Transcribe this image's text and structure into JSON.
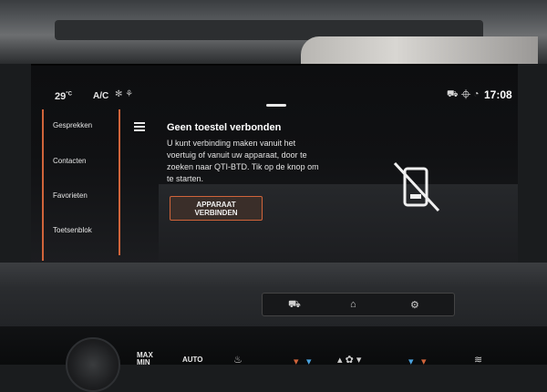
{
  "status": {
    "temperature": "29",
    "temperature_unit": "°C",
    "ac_label": "A/C",
    "clock": "17:08",
    "icons": [
      "fan-icon",
      "car-icon",
      "location-icon",
      "signal-icon"
    ]
  },
  "sidebar": {
    "items": [
      {
        "label": "Gesprekken"
      },
      {
        "label": "Contacten"
      },
      {
        "label": "Favorieten"
      },
      {
        "label": "Toetsenblok"
      }
    ]
  },
  "main": {
    "title": "Geen toestel verbonden",
    "description": "U kunt verbinding maken vanuit het voertuig of vanuit uw apparaat, door te zoeken naar QTI-BTD. Tik op de knop om te starten.",
    "connect_button": "APPARAAT VERBINDEN",
    "status_icon": "phone-disconnected-icon"
  },
  "console": {
    "buttons": [
      "car-icon",
      "home-icon",
      "car-settings-icon"
    ],
    "climate": {
      "max_label": "MAX\nMIN",
      "auto_label": "AUTO"
    }
  },
  "colors": {
    "accent": "#d0643a",
    "background": "#0d0e10",
    "text": "#e6e6e6"
  }
}
